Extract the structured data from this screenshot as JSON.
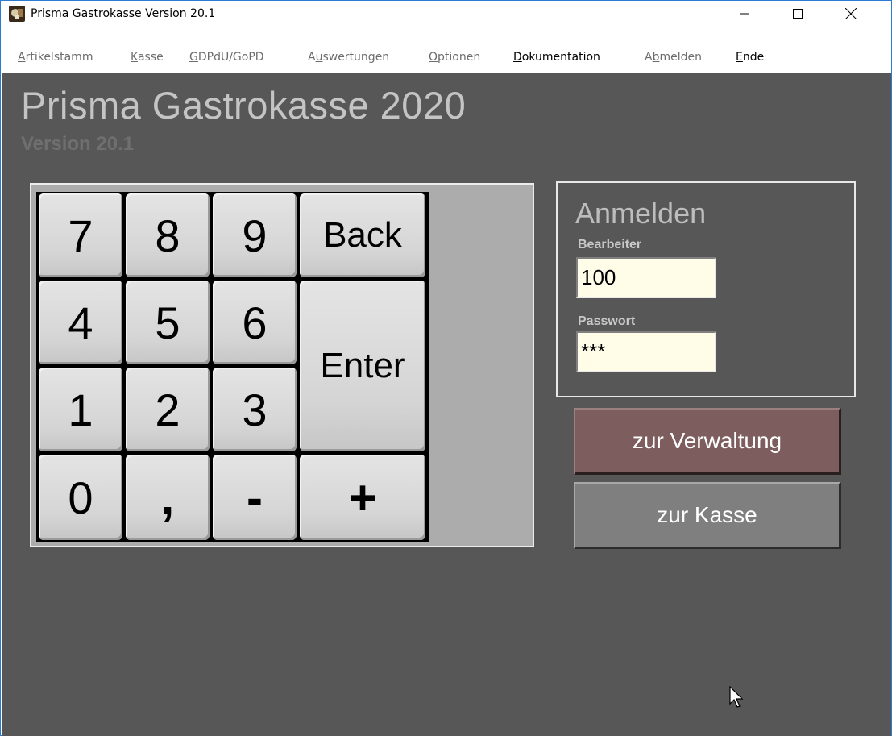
{
  "window": {
    "title": "Prisma Gastrokasse Version 20.1",
    "icon": "app-logo-icon",
    "controls": {
      "minimize": "—",
      "maximize": "☐",
      "close": "✕"
    }
  },
  "menu": [
    {
      "pre": "",
      "u": "A",
      "post": "rtikelstamm",
      "enabled": false
    },
    {
      "pre": "",
      "u": "K",
      "post": "asse",
      "enabled": false
    },
    {
      "pre": "",
      "u": "G",
      "post": "DPdU/GoPD",
      "enabled": false
    },
    {
      "pre": "A",
      "u": "u",
      "post": "swertungen",
      "enabled": false
    },
    {
      "pre": "",
      "u": "O",
      "post": "ptionen",
      "enabled": false
    },
    {
      "pre": "",
      "u": "D",
      "post": "okumentation",
      "enabled": true
    },
    {
      "pre": "A",
      "u": "b",
      "post": "melden",
      "enabled": false
    },
    {
      "pre": "",
      "u": "E",
      "post": "nde",
      "enabled": true
    }
  ],
  "header": {
    "title": "Prisma Gastrokasse 2020",
    "version": "Version 20.1"
  },
  "keypad": {
    "k7": "7",
    "k8": "8",
    "k9": "9",
    "back": "Back",
    "k4": "4",
    "k5": "5",
    "k6": "6",
    "enter": "Enter",
    "k1": "1",
    "k2": "2",
    "k3": "3",
    "k0": "0",
    "comma": ",",
    "minus": "-",
    "plus": "+"
  },
  "login": {
    "title": "Anmelden",
    "user_label": "Bearbeiter",
    "user_value": "100",
    "password_label": "Passwort",
    "password_value": "***"
  },
  "buttons": {
    "verwaltung": "zur Verwaltung",
    "kasse": "zur Kasse"
  },
  "colors": {
    "background": "#575757",
    "verwaltung_button": "#7d5d5d",
    "kasse_button": "#7f7f7f",
    "input_background": "#fffce8"
  }
}
